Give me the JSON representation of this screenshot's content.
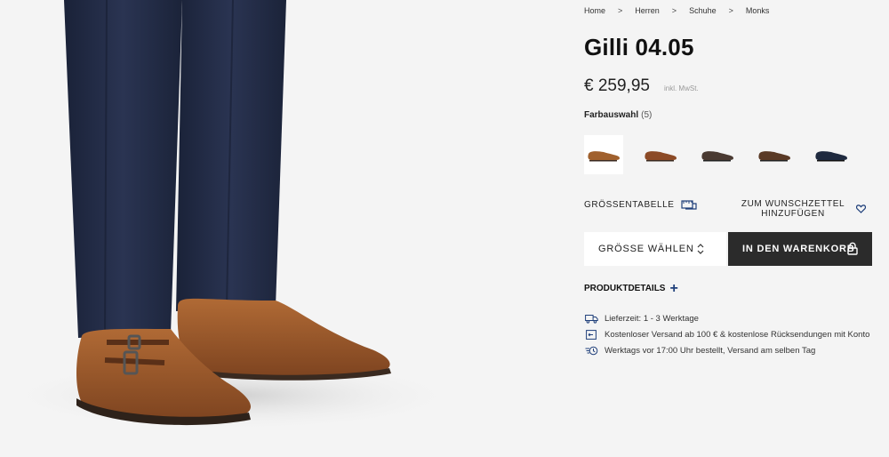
{
  "breadcrumb": {
    "items": [
      "Home",
      "Herren",
      "Schuhe",
      "Monks"
    ],
    "separator": ">"
  },
  "product": {
    "title": "Gilli 04.05",
    "price": "€ 259,95",
    "vat_note": "inkl. MwSt."
  },
  "colors": {
    "label": "Farbauswahl",
    "count": "(5)",
    "swatches": [
      {
        "name": "cognac-suede",
        "color": "#a0602d",
        "selected": true
      },
      {
        "name": "brown-leather",
        "color": "#8c4a26",
        "selected": false
      },
      {
        "name": "dark-brown-leather",
        "color": "#4a3a32",
        "selected": false
      },
      {
        "name": "mocca-suede",
        "color": "#5a3a26",
        "selected": false
      },
      {
        "name": "navy-suede",
        "color": "#1f2a3f",
        "selected": false
      }
    ]
  },
  "actions": {
    "size_table": "GRÖSSENTABELLE",
    "wishlist": "ZUM WUNSCHZETTEL HINZUFÜGEN",
    "size_select": "GRÖSSE WÄHLEN",
    "add_to_cart": "IN DEN WARENKORB"
  },
  "details": {
    "toggle_label": "PRODUKTDETAILS",
    "features": [
      {
        "icon": "truck-icon",
        "text": "Lieferzeit: 1 - 3 Werktage"
      },
      {
        "icon": "return-box-icon",
        "text": "Kostenloser Versand ab 100 € & kostenlose Rücksendungen mit Konto"
      },
      {
        "icon": "fast-delivery-icon",
        "text": "Werktags vor 17:00 Uhr bestellt, Versand am selben Tag"
      }
    ]
  },
  "theme": {
    "accent": "#1f3f7a",
    "button_dark": "#2b2b2b",
    "background": "#f4f4f4"
  }
}
